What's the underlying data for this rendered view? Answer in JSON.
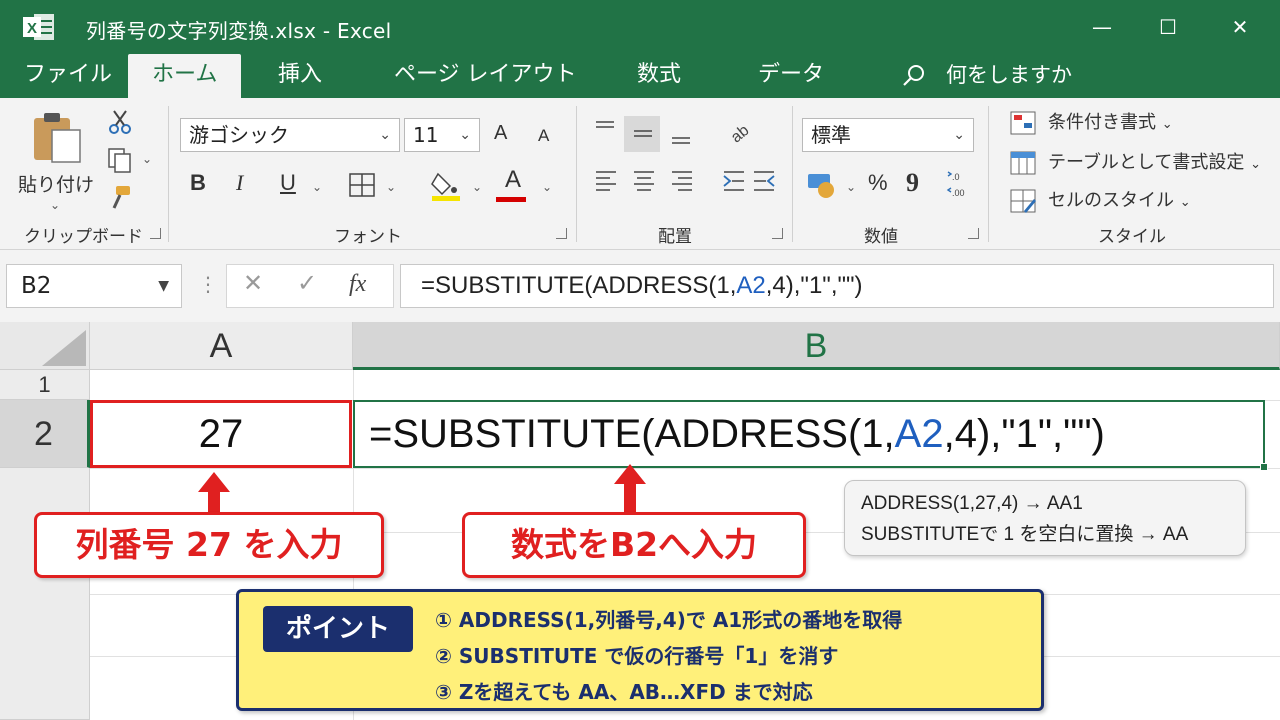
{
  "window": {
    "title": "列番号の文字列変換.xlsx  -  Excel",
    "logo_letter": "X",
    "minimize": "—",
    "maximize": "☐",
    "close": "✕"
  },
  "tabs": [
    {
      "label": "ファイル"
    },
    {
      "label": "ホーム"
    },
    {
      "label": "挿入"
    },
    {
      "label": "ページ レイアウト"
    },
    {
      "label": "数式"
    },
    {
      "label": "データ"
    }
  ],
  "tell_me": "何をしますか",
  "ribbon": {
    "clipboard": {
      "paste_label": "貼り付け",
      "group_label": "クリップボード"
    },
    "font": {
      "font_name": "游ゴシック",
      "font_size": "11",
      "bold": "B",
      "italic": "I",
      "underline": "U",
      "grow": "A",
      "shrink": "A",
      "font_color_letter": "A",
      "group_label": "フォント"
    },
    "alignment": {
      "group_label": "配置"
    },
    "number": {
      "format": "標準",
      "percent": "%",
      "comma": "9",
      "group_label": "数値"
    },
    "styles": {
      "conditional": "条件付き書式",
      "table": "テーブルとして書式設定",
      "cell_styles": "セルのスタイル",
      "group_label": "スタイル"
    }
  },
  "formula_bar": {
    "name_box": "B2",
    "cancel": "✕",
    "enter": "✓",
    "fx": "fx",
    "formula_part1": "=SUBSTITUTE(ADDRESS(1,",
    "formula_ref": "A2",
    "formula_part2": ",4),\"1\",\"\")"
  },
  "grid": {
    "columns": [
      "A",
      "B"
    ],
    "rows": [
      "1",
      "2"
    ],
    "cell_a2": "27",
    "cell_b2_part1": "=SUBSTITUTE(ADDRESS(1,",
    "cell_b2_ref": "A2",
    "cell_b2_part2": ",4),\"1\",\"\")"
  },
  "annotations": {
    "callout_a": "列番号 27 を入力",
    "callout_b": "数式をB2へ入力",
    "info_line1": "ADDRESS(1,27,4) → AA1",
    "info_line2": "SUBSTITUTEで 1 を空白に置換 → AA",
    "point_title": "ポイント",
    "point_lines": [
      "①  ADDRESS(1,列番号,4)で A1形式の番地を取得",
      "②  SUBSTITUTE で仮の行番号「1」を消す",
      "③  Zを超えても AA、AB…XFD まで対応"
    ]
  },
  "colors": {
    "excel_green": "#217346",
    "highlight_red": "#e02020",
    "ref_blue": "#1f5fbf",
    "point_bg": "#fff07a",
    "point_navy": "#1b2f6e"
  }
}
